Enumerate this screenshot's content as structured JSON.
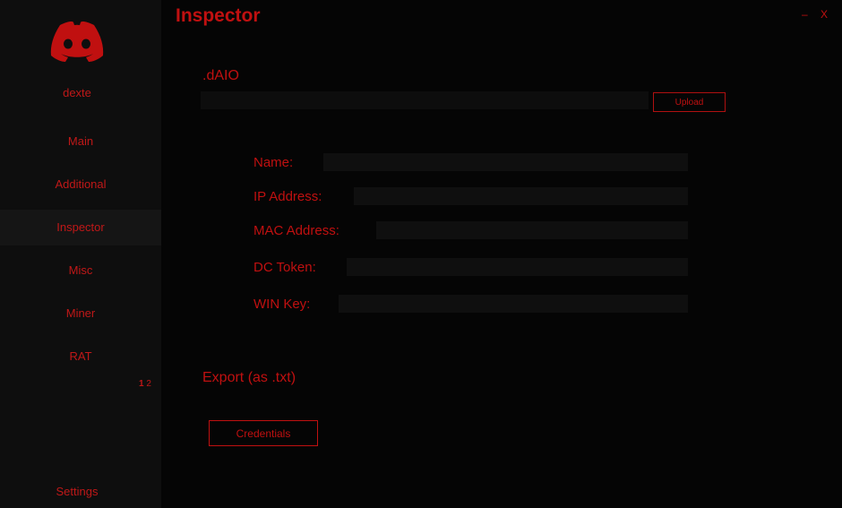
{
  "window": {
    "title": "Inspector",
    "minimize_label": "–",
    "close_label": "X"
  },
  "sidebar": {
    "username": "dexte",
    "items": [
      {
        "label": "Main",
        "active": false
      },
      {
        "label": "Additional",
        "active": false
      },
      {
        "label": "Inspector",
        "active": true
      },
      {
        "label": "Misc",
        "active": false
      },
      {
        "label": "Miner",
        "active": false
      },
      {
        "label": "RAT",
        "active": false
      }
    ],
    "pager": {
      "page1": "1",
      "page2": "2"
    },
    "settings_label": "Settings"
  },
  "main": {
    "file_section_label": ".dAIO",
    "upload_label": "Upload",
    "fields": [
      {
        "label": "Name:",
        "value": ""
      },
      {
        "label": "IP Address:",
        "value": ""
      },
      {
        "label": "MAC Address:",
        "value": ""
      },
      {
        "label": "DC Token:",
        "value": ""
      },
      {
        "label": "WIN Key:",
        "value": ""
      }
    ],
    "export_label": "Export (as .txt)",
    "credentials_label": "Credentials"
  },
  "colors": {
    "accent": "#c01010",
    "background": "#050505",
    "sidebar": "#0e0e0e",
    "field": "#0f0f0f"
  },
  "icons": {
    "logo": "discord-logo-icon"
  }
}
